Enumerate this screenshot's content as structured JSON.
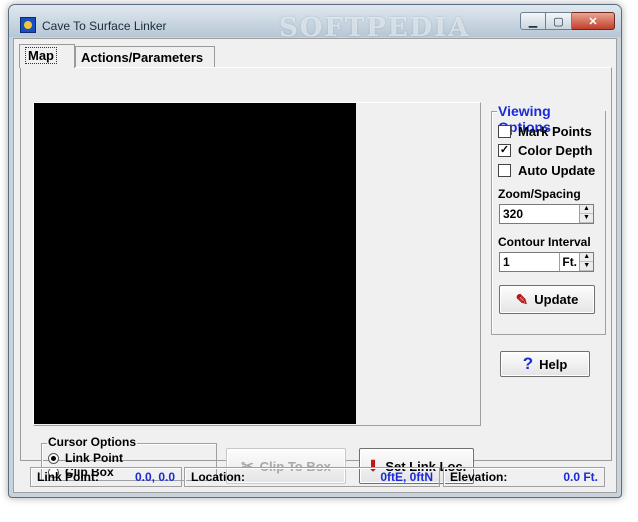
{
  "window": {
    "title": "Cave To Surface Linker",
    "watermark": "SOFTPEDIA",
    "minimize_glyph": "▁",
    "maximize_glyph": "▢",
    "close_glyph": "✕"
  },
  "tabs": [
    {
      "label": "Map",
      "active": true
    },
    {
      "label": "Actions/Parameters",
      "active": false
    }
  ],
  "viewing_options": {
    "title": "Viewing Options",
    "checkboxes": [
      {
        "label": "Mark Points",
        "checked": false
      },
      {
        "label": "Color Depth",
        "checked": true
      },
      {
        "label": "Auto Update",
        "checked": false
      }
    ],
    "zoom_label": "Zoom/Spacing",
    "zoom_value": "320",
    "contour_label": "Contour Interval",
    "contour_value": "1",
    "contour_unit": "Ft.",
    "update_label": "Update"
  },
  "help_label": "Help",
  "cursor_options": {
    "title": "Cursor Options",
    "options": [
      {
        "label": "Link Point",
        "selected": true
      },
      {
        "label": "Clip Box",
        "selected": false
      }
    ]
  },
  "actions": {
    "clip_to_box": "Clip To Box",
    "set_link_loc": "Set Link Loc."
  },
  "status": {
    "link_point_label": "Link Point:",
    "link_point_value": "0.0, 0.0",
    "location_label": "Location:",
    "location_value": "0ftE, 0ftN",
    "elevation_label": "Elevation:",
    "elevation_value": "0.0 Ft."
  },
  "icons": {
    "check": "✓",
    "spin_up": "▲",
    "spin_down": "▼",
    "help": "?",
    "update": "✎",
    "clip": "✂",
    "set_link": "⬇"
  },
  "colors": {
    "accent_blue": "#1a2bd6",
    "map_background": "#000000"
  }
}
